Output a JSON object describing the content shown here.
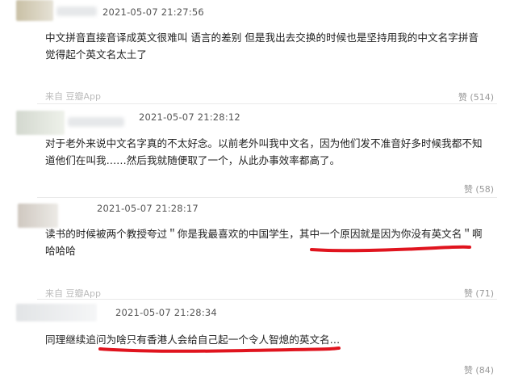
{
  "comments": [
    {
      "timestamp": "2021-05-07 21:27:56",
      "text_lines": [
        "中文拼音直接音译成英文很难叫 语言的差别 但是我出去交换的时候也是坚持用我的中文名字拼音",
        "觉得起个英文名太土了"
      ],
      "source": "来自 豆瓣App",
      "likes": "赞 (514)"
    },
    {
      "timestamp": "2021-05-07 21:28:12",
      "text_lines": [
        "对于老外来说中文名字真的不太好念。以前老外叫我中文名，因为他们发不准音好多时候我都不知",
        "道他们在叫我……然后我就随便取了一个，从此办事效率都高了。"
      ],
      "source": "",
      "likes": "赞 (58)"
    },
    {
      "timestamp": "2021-05-07 21:28:17",
      "text_lines": [
        "读书的时候被两个教授夸过＂你是我最喜欢的中国学生，其中一个原因就是因为你没有英文名＂啊",
        "哈哈哈"
      ],
      "source": "来自 豆瓣App",
      "likes": "赞 (71)"
    },
    {
      "timestamp": "2021-05-07 21:28:34",
      "text_lines": [
        "同理继续追问为啥只有香港人会给自己起一个令人智熄的英文名…"
      ],
      "source": "",
      "likes": "赞 (84)"
    }
  ],
  "colors": {
    "underline": "#e0141e",
    "text": "#222222",
    "meta": "#999999"
  }
}
